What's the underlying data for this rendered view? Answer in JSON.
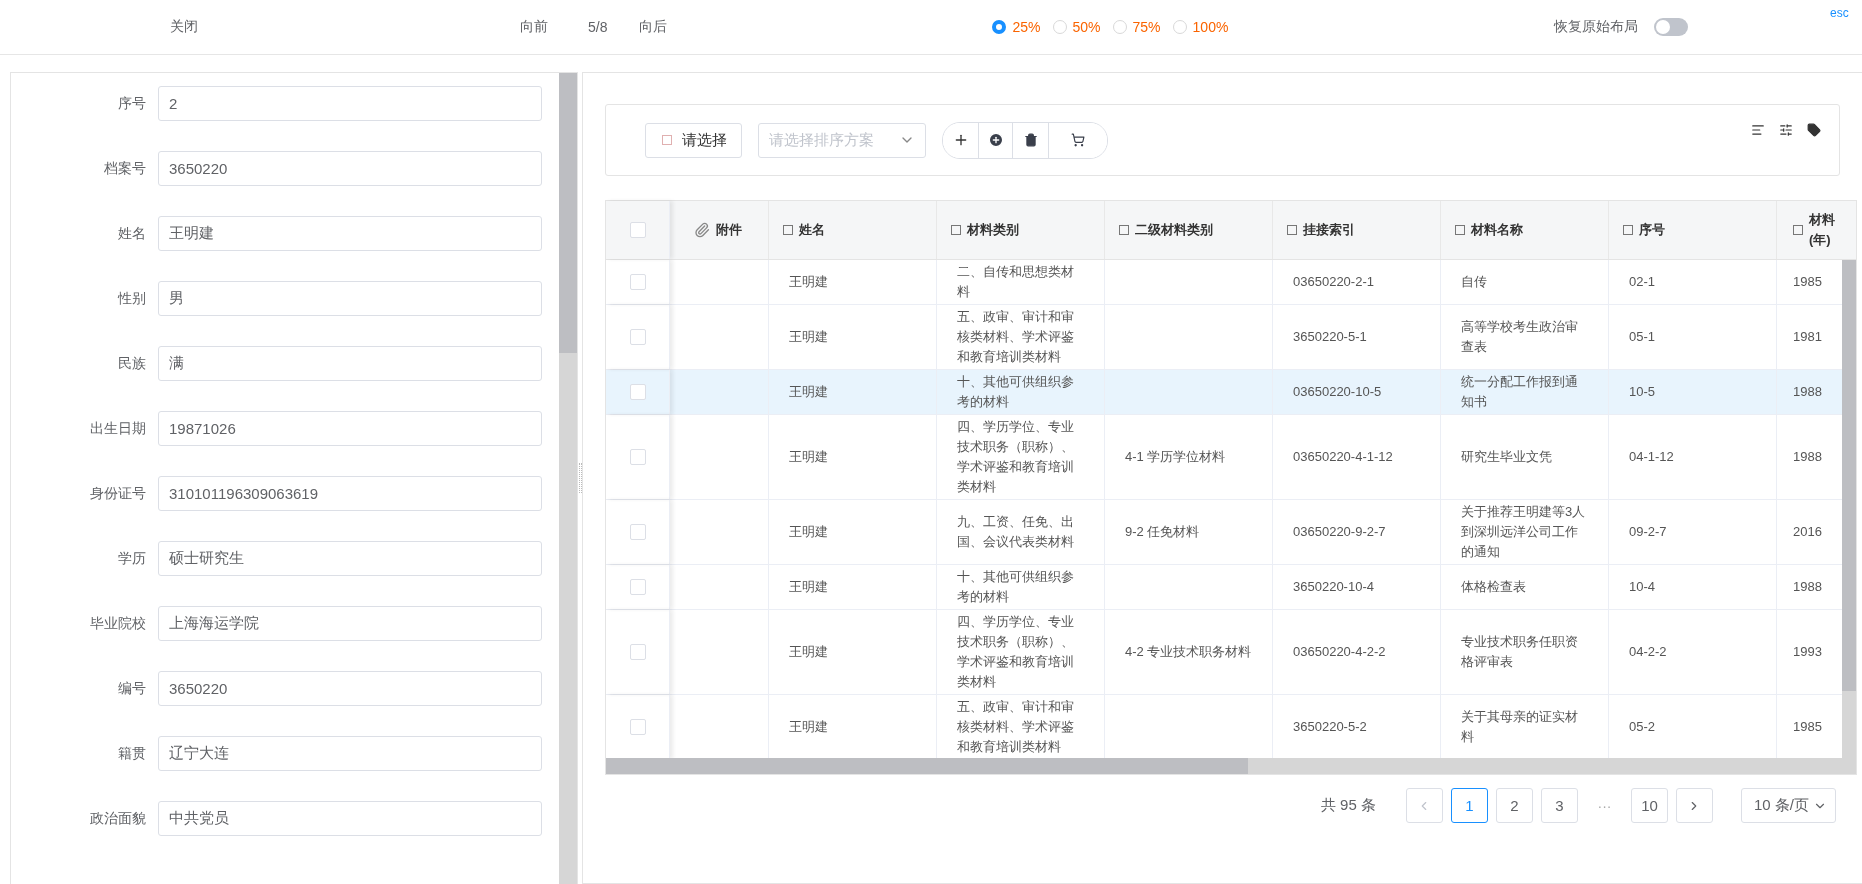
{
  "top_bar": {
    "close": "关闭",
    "prev": "向前",
    "position": "5/8",
    "next": "向后",
    "zoom_options": [
      {
        "label": "25%",
        "selected": true
      },
      {
        "label": "50%",
        "selected": false
      },
      {
        "label": "75%",
        "selected": false
      },
      {
        "label": "100%",
        "selected": false
      }
    ],
    "reset_layout": {
      "label": "恢复原始布局",
      "on": false
    },
    "hint": "esc"
  },
  "form": {
    "fields": [
      {
        "label": "序号",
        "value": "2"
      },
      {
        "label": "档案号",
        "value": "3650220"
      },
      {
        "label": "姓名",
        "value": "王明建"
      },
      {
        "label": "性别",
        "value": "男"
      },
      {
        "label": "民族",
        "value": "满"
      },
      {
        "label": "出生日期",
        "value": "19871026"
      },
      {
        "label": "身份证号",
        "value": "310101196309063619"
      },
      {
        "label": "学历",
        "value": "硕士研究生"
      },
      {
        "label": "毕业院校",
        "value": "上海海运学院"
      },
      {
        "label": "编号",
        "value": "3650220"
      },
      {
        "label": "籍贯",
        "value": "辽宁大连"
      },
      {
        "label": "政治面貌",
        "value": "中共党员"
      }
    ]
  },
  "toolbar": {
    "select_button": "请选择",
    "sort_select": {
      "placeholder": "请选择排序方案"
    }
  },
  "table": {
    "header_checked": false,
    "columns": [
      {
        "kind": "attachment",
        "label": "附件"
      },
      {
        "kind": "field",
        "label": "姓名",
        "checked": false
      },
      {
        "kind": "field",
        "label": "材料类别",
        "checked": false
      },
      {
        "kind": "field",
        "label": "二级材料类别",
        "checked": false
      },
      {
        "kind": "field",
        "label": "挂接索引",
        "checked": false
      },
      {
        "kind": "field",
        "label": "材料名称",
        "checked": false
      },
      {
        "kind": "field",
        "label": "序号",
        "checked": false
      },
      {
        "kind": "field",
        "label": "材料(年)",
        "checked": false
      }
    ],
    "rows": [
      {
        "checked": false,
        "selected": false,
        "name": "王明建",
        "category": "二、自传和思想类材料",
        "index": "03650220-2-1",
        "title": "自传",
        "seq": "02-1",
        "year": "1985"
      },
      {
        "checked": false,
        "selected": false,
        "name": "王明建",
        "category": "五、政审、审计和审核类材料、学术评鉴和教育培训类材料",
        "index": "3650220-5-1",
        "title": "高等学校考生政治审查表",
        "seq": "05-1",
        "year": "1981"
      },
      {
        "checked": false,
        "selected": true,
        "name": "王明建",
        "category": "十、其他可供组织参考的材料",
        "index": "03650220-10-5",
        "title": "统一分配工作报到通知书",
        "seq": "10-5",
        "year": "1988"
      },
      {
        "checked": false,
        "selected": false,
        "name": "王明建",
        "category": "四、学历学位、专业技术职务（职称）、学术评鉴和教育培训类材料",
        "sub_category": "4-1 学历学位材料",
        "index": "03650220-4-1-12",
        "title": "研究生毕业文凭",
        "seq": "04-1-12",
        "year": "1988"
      },
      {
        "checked": false,
        "selected": false,
        "name": "王明建",
        "category": "九、工资、任免、出国、会议代表类材料",
        "sub_category": "9-2 任免材料",
        "index": "03650220-9-2-7",
        "title": "关于推荐王明建等3人到深圳远洋公司工作的通知",
        "seq": "09-2-7",
        "year": "2016"
      },
      {
        "checked": false,
        "selected": false,
        "name": "王明建",
        "category": "十、其他可供组织参考的材料",
        "index": "3650220-10-4",
        "title": "体格检查表",
        "seq": "10-4",
        "year": "1988"
      },
      {
        "checked": false,
        "selected": false,
        "name": "王明建",
        "category": "四、学历学位、专业技术职务（职称）、学术评鉴和教育培训类材料",
        "sub_category": "4-2 专业技术职务材料",
        "index": "03650220-4-2-2",
        "title": "专业技术职务任职资格评审表",
        "seq": "04-2-2",
        "year": "1993"
      },
      {
        "checked": false,
        "selected": false,
        "name": "王明建",
        "category": "五、政审、审计和审核类材料、学术评鉴和教育培训类材料",
        "index": "3650220-5-2",
        "title": "关于其母亲的证实材料",
        "seq": "05-2",
        "year": "1985"
      }
    ]
  },
  "pagination": {
    "total": "共 95 条",
    "prev": {
      "disabled": true
    },
    "next": {
      "disabled": false
    },
    "pages": [
      {
        "kind": "page",
        "label": "1",
        "selected": true
      },
      {
        "kind": "page",
        "label": "2",
        "selected": false
      },
      {
        "kind": "page",
        "label": "3",
        "selected": false
      },
      {
        "kind": "ellipsis",
        "label": "···",
        "selected": false
      },
      {
        "kind": "page",
        "label": "10",
        "selected": false
      }
    ],
    "page_size": "10 条/页"
  }
}
